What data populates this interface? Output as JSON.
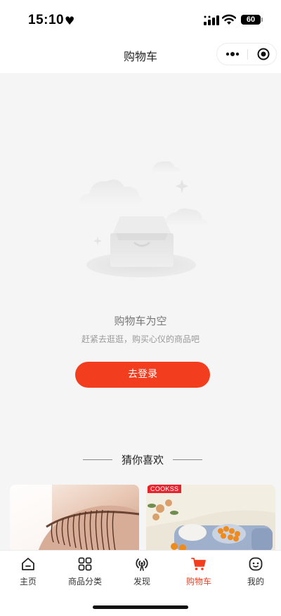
{
  "status_bar": {
    "time": "15:10",
    "battery": "60",
    "heart_icon": "heart-icon",
    "signal_icon": "signal-icon",
    "wifi_icon": "wifi-icon"
  },
  "nav": {
    "title": "购物车",
    "more_icon": "more-dots-icon",
    "close_icon": "target-icon"
  },
  "empty_state": {
    "illustration_icon": "empty-box-icon",
    "title": "购物车为空",
    "subtitle": "赶紧去逛逛，购买心仪的商品吧",
    "button_label": "去登录"
  },
  "recommendations": {
    "title": "猜你喜欢",
    "products": [
      {
        "image": "eyelash-photo"
      },
      {
        "image": "fruit-tray-photo",
        "brand_tag": "COOKSS"
      }
    ]
  },
  "tab_bar": {
    "tabs": [
      {
        "label": "主页",
        "icon": "home-icon"
      },
      {
        "label": "商品分类",
        "icon": "grid-icon"
      },
      {
        "label": "发现",
        "icon": "broadcast-icon"
      },
      {
        "label": "购物车",
        "icon": "cart-icon",
        "active": true
      },
      {
        "label": "我的",
        "icon": "face-icon"
      }
    ]
  },
  "colors": {
    "accent": "#f23d1f",
    "background": "#f5f5f5",
    "brand_tag": "#e8232e"
  }
}
